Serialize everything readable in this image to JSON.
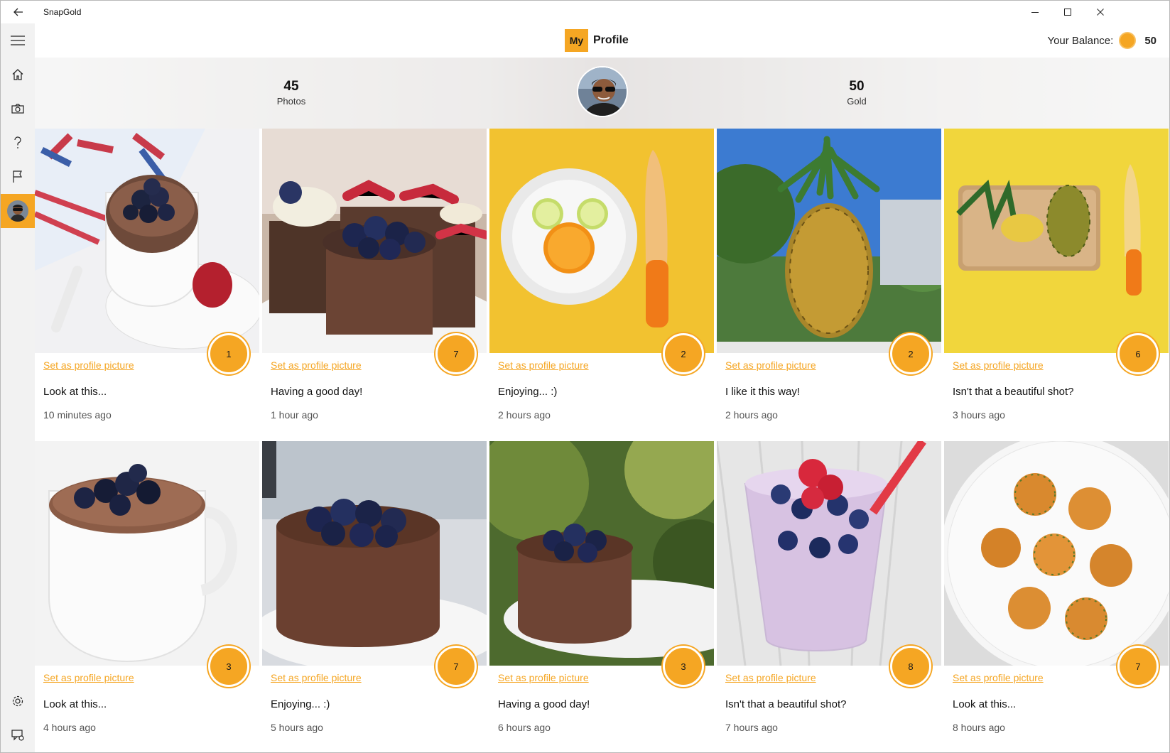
{
  "app": {
    "title": "SnapGold"
  },
  "header": {
    "title_badge": "My",
    "title": "Profile",
    "balance_label": "Your Balance:",
    "balance_value": "50"
  },
  "stats": {
    "photos_count": "45",
    "photos_label": "Photos",
    "gold_count": "50",
    "gold_label": "Gold"
  },
  "nav": [
    {
      "name": "home-icon"
    },
    {
      "name": "camera-icon"
    },
    {
      "name": "help-icon"
    },
    {
      "name": "flag-icon"
    },
    {
      "name": "avatar"
    }
  ],
  "bottom_nav": [
    {
      "name": "settings-icon"
    },
    {
      "name": "feedback-icon"
    }
  ],
  "colors": {
    "accent": "#f5a623",
    "rail": "#f2f2f2"
  },
  "posts": [
    {
      "link": "Set as profile picture",
      "caption": "Look at this...",
      "time": "10 minutes ago",
      "gold": "1",
      "photo": "hot-chocolate-cup-blueberries"
    },
    {
      "link": "Set as profile picture",
      "caption": "Having a good day!",
      "time": "1 hour ago",
      "gold": "7",
      "photo": "chocolate-cakes-berries"
    },
    {
      "link": "Set as profile picture",
      "caption": "Enjoying... :)",
      "time": "2 hours ago",
      "gold": "2",
      "photo": "fruit-plate-knife-yellow"
    },
    {
      "link": "Set as profile picture",
      "caption": "I like it this way!",
      "time": "2 hours ago",
      "gold": "2",
      "photo": "pineapple-blue-sky"
    },
    {
      "link": "Set as profile picture",
      "caption": "Isn't that a beautiful shot?",
      "time": "3 hours ago",
      "gold": "6",
      "photo": "sliced-pineapple-board"
    },
    {
      "link": "Set as profile picture",
      "caption": "Look at this...",
      "time": "4 hours ago",
      "gold": "3",
      "photo": "white-cup-blueberries"
    },
    {
      "link": "Set as profile picture",
      "caption": "Enjoying... :)",
      "time": "5 hours ago",
      "gold": "7",
      "photo": "chocolate-cake-blueberries"
    },
    {
      "link": "Set as profile picture",
      "caption": "Having a good day!",
      "time": "6 hours ago",
      "gold": "3",
      "photo": "chocolate-cake-plate-green"
    },
    {
      "link": "Set as profile picture",
      "caption": "Isn't that a beautiful shot?",
      "time": "7 hours ago",
      "gold": "8",
      "photo": "berry-smoothie-glass"
    },
    {
      "link": "Set as profile picture",
      "caption": "Look at this...",
      "time": "8 hours ago",
      "gold": "7",
      "photo": "egg-muffins-plate"
    }
  ]
}
